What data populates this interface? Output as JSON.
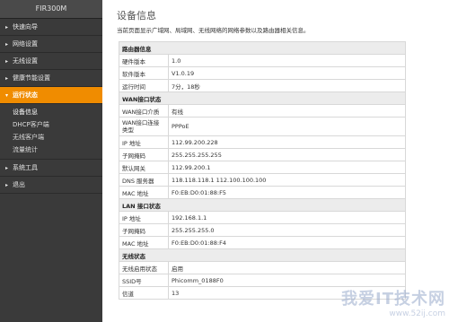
{
  "sidebar": {
    "brand": "FIR300M",
    "items": [
      {
        "label": "快速向导",
        "arrow": "▸"
      },
      {
        "label": "网络设置",
        "arrow": "▸"
      },
      {
        "label": "无线设置",
        "arrow": "▸"
      },
      {
        "label": "健康节能设置",
        "arrow": "▸"
      },
      {
        "label": "运行状态",
        "arrow": "▾"
      },
      {
        "label": "系统工具",
        "arrow": "▸"
      },
      {
        "label": "退出",
        "arrow": "▸"
      }
    ],
    "subitems": [
      "设备信息",
      "DHCP客户端",
      "无线客户端",
      "流量统计"
    ]
  },
  "main": {
    "title": "设备信息",
    "desc": "当前页面显示广域网、局域网、无线网络的网络参数以及路由器相关信息。",
    "router": {
      "header": "路由器信息",
      "rows": [
        {
          "k": "硬件版本",
          "v": "1.0"
        },
        {
          "k": "软件版本",
          "v": "V1.0.19"
        },
        {
          "k": "运行时间",
          "v": "7分，18秒"
        }
      ]
    },
    "wan": {
      "header": "WAN接口状态",
      "row0": {
        "k": "WAN接口介质",
        "v": "有线"
      },
      "row1": {
        "k1": "WAN接口连接",
        "k2": "类型",
        "v": "PPPoE"
      },
      "rows": [
        {
          "k": "IP 地址",
          "v": "112.99.200.228"
        },
        {
          "k": "子网掩码",
          "v": "255.255.255.255"
        },
        {
          "k": "默认网关",
          "v": "112.99.200.1"
        },
        {
          "k": "DNS 服务器",
          "v": "118.118.118.1 112.100.100.100"
        },
        {
          "k": "MAC 地址",
          "v": "F0:EB:D0:01:88:F5"
        }
      ]
    },
    "lan": {
      "header": "LAN 接口状态",
      "rows": [
        {
          "k": "IP 地址",
          "v": "192.168.1.1"
        },
        {
          "k": "子网掩码",
          "v": "255.255.255.0"
        },
        {
          "k": "MAC 地址",
          "v": "F0:EB:D0:01:88:F4"
        }
      ]
    },
    "wireless": {
      "header": "无线状态",
      "rows": [
        {
          "k": "无线启用状态",
          "v": "启用"
        },
        {
          "k": "SSID号",
          "v": "Phicomm_0188F0"
        },
        {
          "k": "信道",
          "v": "13"
        }
      ]
    }
  },
  "watermark": {
    "text": "我爱IT技术网",
    "url": "www.52ij.com"
  },
  "colors": {
    "sidebar_bg": "#3a3a3a",
    "active": "#f08c00"
  }
}
